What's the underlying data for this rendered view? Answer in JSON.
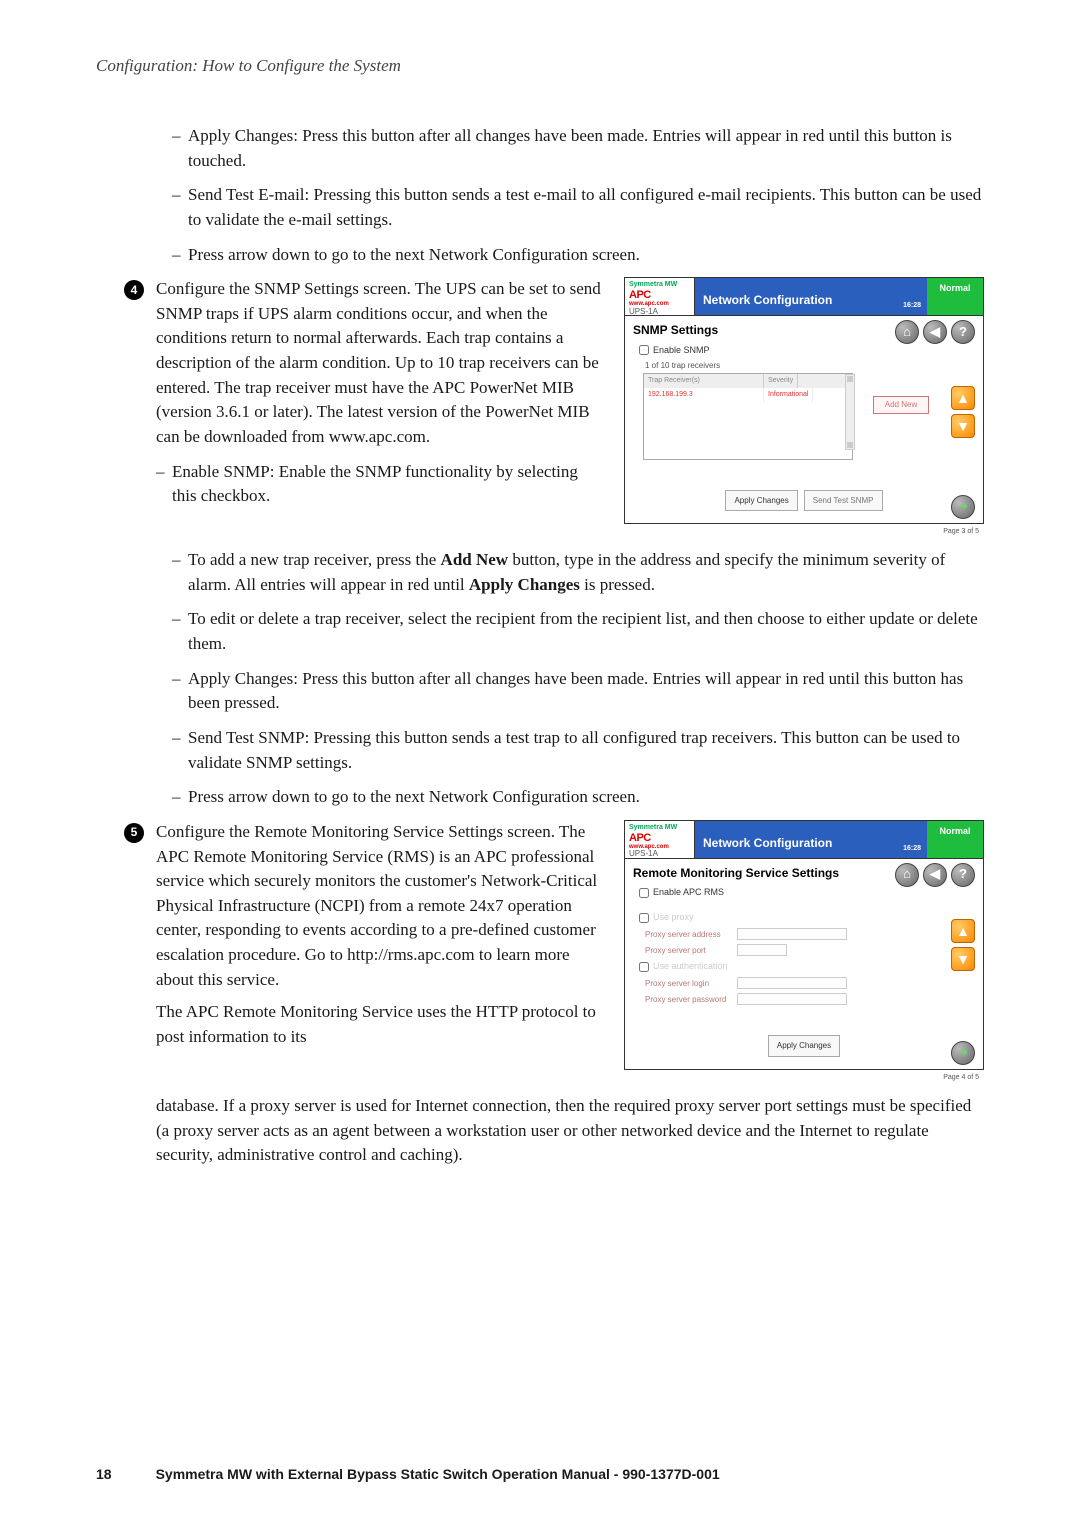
{
  "header": {
    "title": "Configuration: How to Configure the System"
  },
  "intro_bullets": [
    "Apply Changes: Press this button after all changes have been made. Entries will appear in red until this button is touched.",
    "Send Test E-mail: Pressing this button sends a test e-mail to all configured e-mail recipients. This button can be used to validate the e-mail settings.",
    "Press arrow down to go to the next Network Configuration screen."
  ],
  "step4": {
    "num": "4",
    "text": "Configure the SNMP Settings screen. The UPS can be set to send SNMP traps if UPS alarm conditions occur, and when the conditions return to normal afterwards. Each trap contains a description of the alarm condition. Up to 10 trap receivers can be entered. The trap receiver must have the APC PowerNet MIB (version 3.6.1 or later). The latest version of the PowerNet MIB can be downloaded from www.apc.com.",
    "bullets": [
      "Enable SNMP: Enable the SNMP functionality by selecting this checkbox.",
      "To add a new trap receiver, press the Add New button, type in the address and specify the minimum severity of alarm. All entries will appear in red until Apply Changes is pressed.",
      "To edit or delete a trap receiver, select the recipient from the recipient list, and then choose to either update or delete them.",
      "Apply Changes: Press this button after all changes have been made. Entries will appear in red until this button has been pressed.",
      "Send Test SNMP: Pressing this button sends a test trap to all configured trap receivers. This button can be used to validate SNMP settings.",
      "Press arrow down to go to the next Network Configuration screen."
    ]
  },
  "step5": {
    "num": "5",
    "text1": "Configure the Remote Monitoring Service Settings screen. The APC Remote Monitoring Service (RMS) is an APC professional service which securely monitors the customer's Network-Critical Physical Infrastructure (NCPI) from a remote 24x7 operation center, responding to events according to a pre-defined customer escalation procedure. Go to http://rms.apc.com to learn more about this service.",
    "text2": "The APC Remote Monitoring Service uses the HTTP protocol to post information to its",
    "text3": "database. If a proxy server is used for Internet connection, then the required proxy server port settings must be specified (a proxy server acts as an agent between a workstation user or other networked device and the Internet to regulate security, administrative control and caching)."
  },
  "snmp_screenshot": {
    "brand_line": "Symmetra MW",
    "apc": "APC",
    "url": "www.apc.com",
    "ups": "UPS-1A",
    "title": "Network Configuration",
    "status": "Normal",
    "time": "16:28",
    "heading": "SNMP Settings",
    "enable": "Enable SNMP",
    "sub": "1 of 10 trap receivers",
    "col1": "Trap Receiver(s)",
    "col2": "Severity",
    "row_ip": "192.168.199.3",
    "row_sev": "Informational",
    "add_new": "Add New",
    "btn_apply": "Apply Changes",
    "btn_send": "Send Test SNMP",
    "pager": "Page 3 of 5"
  },
  "rms_screenshot": {
    "brand_line": "Symmetra MW",
    "apc": "APC",
    "url": "www.apc.com",
    "ups": "UPS-1A",
    "title": "Network Configuration",
    "status": "Normal",
    "time": "16:28",
    "heading": "Remote Monitoring Service Settings",
    "enable": "Enable APC RMS",
    "use_proxy": "Use proxy",
    "proxy_addr": "Proxy server address",
    "proxy_port": "Proxy server port",
    "use_auth": "Use authentication",
    "proxy_login": "Proxy server login",
    "proxy_pass": "Proxy server password",
    "btn_apply": "Apply Changes",
    "pager": "Page 4 of 5"
  },
  "footer": {
    "page": "18",
    "title": "Symmetra MW with External Bypass Static Switch Operation Manual - 990-1377D-001"
  }
}
